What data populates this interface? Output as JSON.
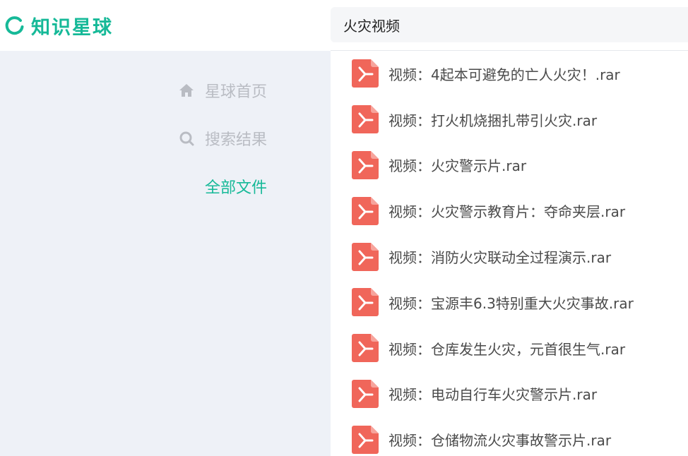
{
  "brand": {
    "name": "知识星球",
    "color": "#16b998"
  },
  "search": {
    "query": "火灾视频"
  },
  "sidebar": {
    "items": [
      {
        "label": "星球首页",
        "icon": "home-icon",
        "active": false
      },
      {
        "label": "搜索结果",
        "icon": "search-icon",
        "active": false
      },
      {
        "label": "全部文件",
        "icon": "",
        "active": true
      }
    ],
    "active_color": "#16b998",
    "inactive_color": "#b9bcc3"
  },
  "files": [
    {
      "name": "视频：4起本可避免的亡人火灾！.rar",
      "icon": "pdf-file-icon"
    },
    {
      "name": "视频：打火机烧捆扎带引火灾.rar",
      "icon": "pdf-file-icon"
    },
    {
      "name": "视频：火灾警示片.rar",
      "icon": "pdf-file-icon"
    },
    {
      "name": "视频：火灾警示教育片：夺命夹层.rar",
      "icon": "pdf-file-icon"
    },
    {
      "name": "视频：消防火灾联动全过程演示.rar",
      "icon": "pdf-file-icon"
    },
    {
      "name": "视频：宝源丰6.3特别重大火灾事故.rar",
      "icon": "pdf-file-icon"
    },
    {
      "name": "视频：仓库发生火灾，元首很生气.rar",
      "icon": "pdf-file-icon"
    },
    {
      "name": "视频：电动自行车火灾警示片.rar",
      "icon": "pdf-file-icon"
    },
    {
      "name": "视频：仓储物流火灾事故警示片.rar",
      "icon": "pdf-file-icon"
    }
  ],
  "file_icon_color": "#f0665a"
}
